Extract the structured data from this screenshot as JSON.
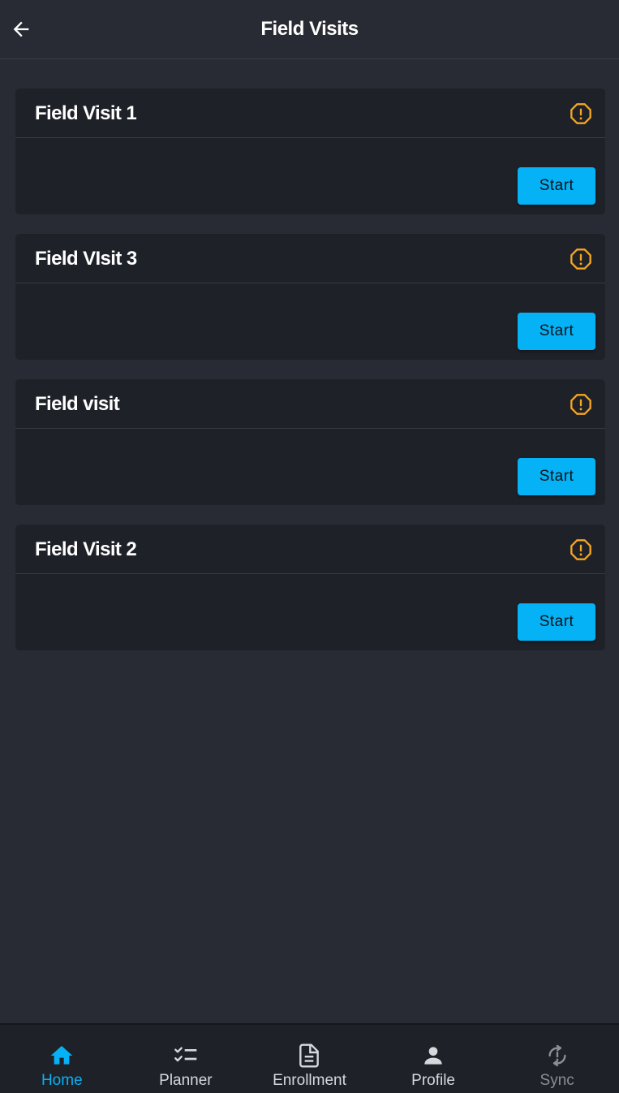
{
  "header": {
    "title": "Field Visits",
    "back_icon": "arrow-left-icon"
  },
  "cards": [
    {
      "title": "Field Visit 1",
      "button_label": "Start",
      "status_icon": "warning-octagon-icon"
    },
    {
      "title": "Field VIsit 3",
      "button_label": "Start",
      "status_icon": "warning-octagon-icon"
    },
    {
      "title": "Field visit",
      "button_label": "Start",
      "status_icon": "warning-octagon-icon"
    },
    {
      "title": "Field Visit 2",
      "button_label": "Start",
      "status_icon": "warning-octagon-icon"
    }
  ],
  "nav": {
    "items": [
      {
        "label": "Home",
        "icon": "home-icon",
        "active": true
      },
      {
        "label": "Planner",
        "icon": "checklist-icon",
        "active": false
      },
      {
        "label": "Enrollment",
        "icon": "document-icon",
        "active": false
      },
      {
        "label": "Profile",
        "icon": "person-icon",
        "active": false
      },
      {
        "label": "Sync",
        "icon": "sync-alert-icon",
        "active": false
      }
    ]
  },
  "colors": {
    "background": "#282b33",
    "card": "#1f2129",
    "accent": "#04b2f5",
    "warning": "#f5a623"
  }
}
